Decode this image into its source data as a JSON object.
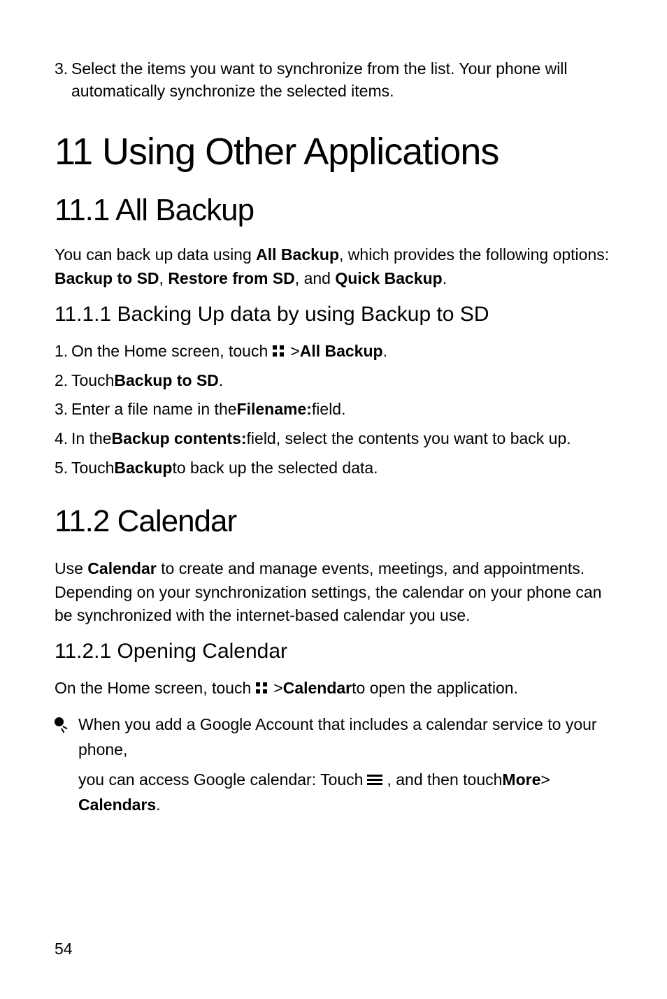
{
  "intro_step": {
    "num": "3.",
    "text": "Select the items you want to synchronize from the list. Your phone will automatically synchronize the selected items."
  },
  "h1": "11  Using Other Applications",
  "section_11_1": {
    "heading": "11.1  All Backup",
    "para_prefix": "You can back up data using ",
    "para_bold1": "All Backup",
    "para_mid1": ", which provides the following options: ",
    "para_bold2": "Backup to SD",
    "para_sep1": ", ",
    "para_bold3": "Restore from SD",
    "para_sep2": ", and ",
    "para_bold4": "Quick Backup",
    "para_end": ".",
    "sub_heading": "11.1.1  Backing Up data by using Backup to SD",
    "steps": {
      "s1_num": "1.",
      "s1_pre": "On the Home screen, touch ",
      "s1_post_gt": " > ",
      "s1_bold": "All Backup",
      "s1_end": ".",
      "s2_num": "2.",
      "s2_pre": "Touch ",
      "s2_bold": "Backup to SD",
      "s2_end": ".",
      "s3_num": "3.",
      "s3_pre": "Enter a file name in the ",
      "s3_bold": "Filename:",
      "s3_end": " field.",
      "s4_num": "4.",
      "s4_pre": "In the ",
      "s4_bold": "Backup contents:",
      "s4_end": " field, select the contents you want to back up.",
      "s5_num": "5.",
      "s5_pre": "Touch ",
      "s5_bold": "Backup",
      "s5_end": " to back up the selected data."
    }
  },
  "section_11_2": {
    "heading": "11.2  Calendar",
    "para_pre": "Use ",
    "para_bold": "Calendar",
    "para_rest": " to create and manage events, meetings, and appointments. Depending on your synchronization settings, the calendar on your phone can be synchronized with the internet-based calendar you use.",
    "sub_heading": "11.2.1  Opening Calendar",
    "open_pre": "On the Home screen, touch ",
    "open_gt": " > ",
    "open_bold": "Calendar",
    "open_end": " to open the application.",
    "tip_line1": "When you add a Google Account that includes a calendar service to your phone, ",
    "tip_line2_pre": "you can access Google calendar: Touch ",
    "tip_line2_mid": " , and then touch ",
    "tip_line2_bold": "More",
    "tip_line2_gt": " > ",
    "tip_line3_bold": "Calendars",
    "tip_line3_end": "."
  },
  "page_number": "54"
}
